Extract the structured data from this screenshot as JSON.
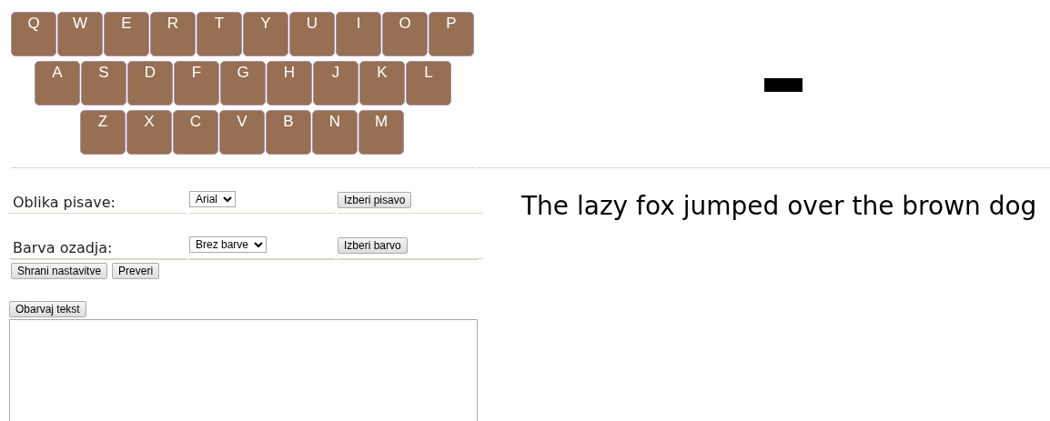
{
  "keyboard": {
    "rows": [
      [
        "Q",
        "W",
        "E",
        "R",
        "T",
        "Y",
        "U",
        "I",
        "O",
        "P"
      ],
      [
        "A",
        "S",
        "D",
        "F",
        "G",
        "H",
        "J",
        "K",
        "L"
      ],
      [
        "Z",
        "X",
        "C",
        "V",
        "B",
        "N",
        "M"
      ]
    ]
  },
  "settings": [
    {
      "label": "Oblika pisave:",
      "value": "Arial",
      "button": "Izberi pisavo"
    },
    {
      "label": "Barva ozadja:",
      "value": "Brez barve",
      "button": "Izberi barvo"
    }
  ],
  "actions": [
    "Shrani nastavitve",
    "Preveri"
  ],
  "color_text_button": "Obarvaj tekst",
  "preview_text": "The lazy fox jumped over the brown dog"
}
